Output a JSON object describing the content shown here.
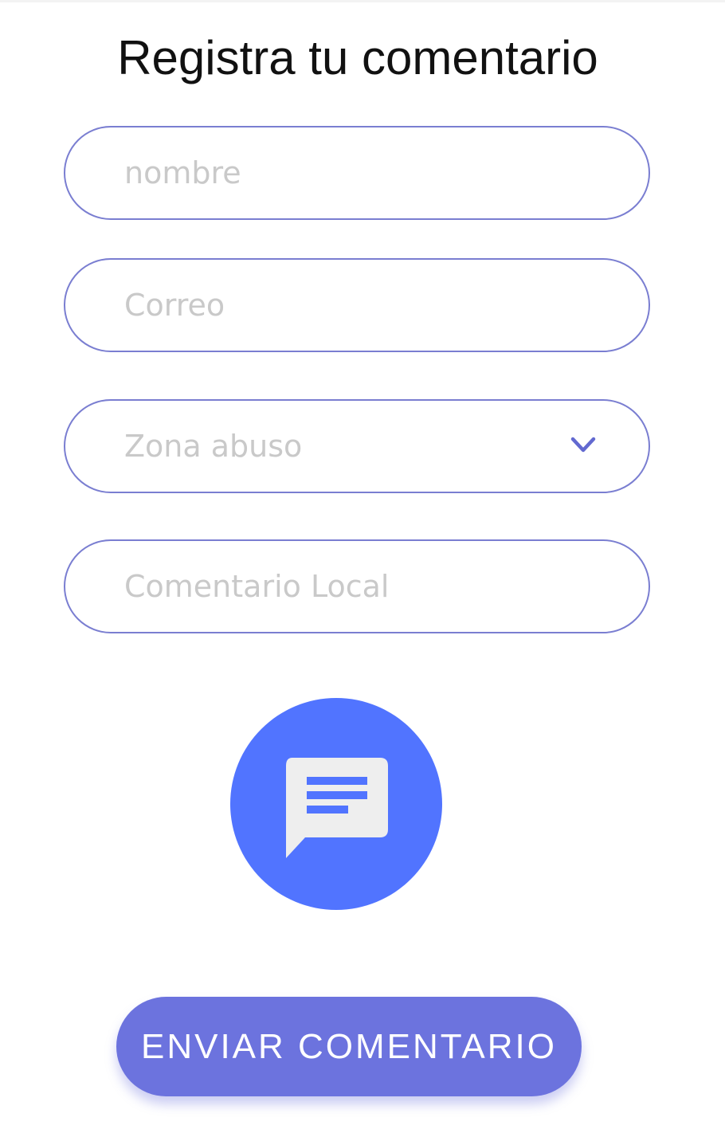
{
  "form": {
    "title": "Registra tu comentario",
    "fields": [
      {
        "placeholder": "nombre",
        "value": ""
      },
      {
        "placeholder": "Correo",
        "value": ""
      }
    ],
    "zone_select": {
      "placeholder": "Zona abuso",
      "icon": "chevron-down-icon"
    },
    "comment_field": {
      "placeholder": "Comentario Local",
      "value": ""
    },
    "comment_icon": "message-icon",
    "submit_label": "ENVIAR COMENTARIO"
  },
  "colors": {
    "field_border": "#7a7ed1",
    "placeholder": "#c9c9c9",
    "fab_background": "#5174ff",
    "submit_background": "#6c73de",
    "icon_background": "#eeeeee"
  }
}
